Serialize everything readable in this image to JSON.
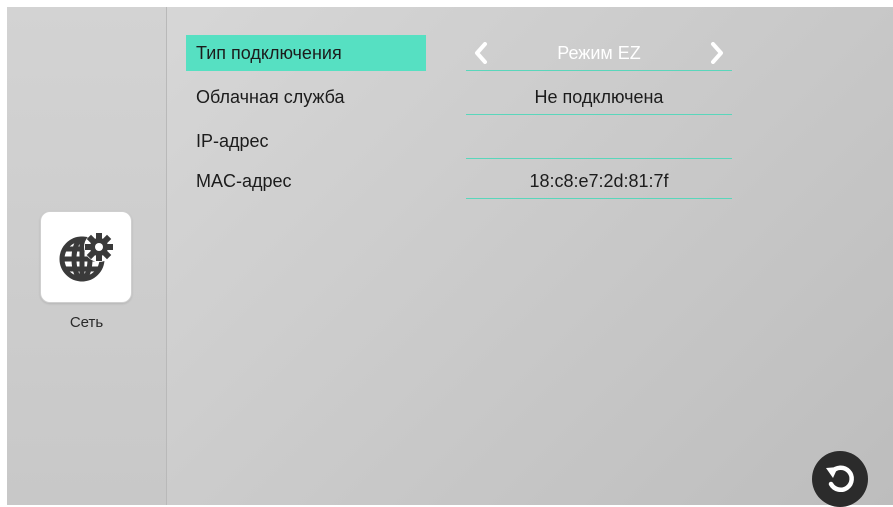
{
  "sidebar": {
    "app": {
      "label": "Сеть",
      "icon": "globe-gear-icon"
    }
  },
  "rows": [
    {
      "label": "Тип подключения",
      "value": "Режим EZ",
      "selected": true
    },
    {
      "label": "Облачная служба",
      "value": "Не подключена"
    },
    {
      "label": "IP-адрес",
      "value": ""
    },
    {
      "label": "MAC-адрес",
      "value": "18:c8:e7:2d:81:7f"
    }
  ],
  "controls": {
    "prev_icon": "chevron-left-icon",
    "next_icon": "chevron-right-icon",
    "back_icon": "undo-back-icon"
  },
  "colors": {
    "accent": "#56e0c2",
    "underline": "#5ad6bb",
    "back_button": "#2b2b2b"
  }
}
